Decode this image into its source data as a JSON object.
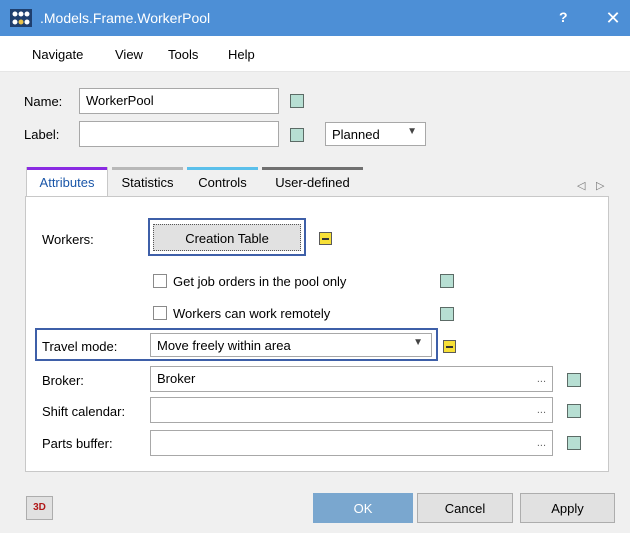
{
  "window": {
    "title": ".Models.Frame.WorkerPool",
    "help": "?",
    "close": "✕"
  },
  "menu": {
    "items": [
      "Navigate",
      "View",
      "Tools",
      "Help"
    ]
  },
  "name": {
    "label": "Name:",
    "value": "WorkerPool"
  },
  "label_field": {
    "label": "Label:",
    "value": ""
  },
  "status_combo": {
    "value": "Planned"
  },
  "tabs": [
    {
      "label": "Attributes",
      "color": "#8a2be2",
      "active": true
    },
    {
      "label": "Statistics",
      "color": "#b8b8b8",
      "active": false
    },
    {
      "label": "Controls",
      "color": "#5bc0eb",
      "active": false
    },
    {
      "label": "User-defined",
      "color": "#707070",
      "active": false
    }
  ],
  "tab_nav": {
    "left": "◁",
    "right": "▷"
  },
  "attributes": {
    "workers_label": "Workers:",
    "creation_table_button": "Creation Table",
    "pool_only_checkbox": "Get job orders in the pool only",
    "remote_checkbox": "Workers can work remotely",
    "travel_mode_label": "Travel mode:",
    "travel_mode_value": "Move freely within area",
    "broker_label": "Broker:",
    "broker_value": "Broker",
    "shift_calendar_label": "Shift calendar:",
    "shift_calendar_value": "",
    "parts_buffer_label": "Parts buffer:",
    "parts_buffer_value": "",
    "ellipsis": "..."
  },
  "footer": {
    "three_d": "3D",
    "ok": "OK",
    "cancel": "Cancel",
    "apply": "Apply"
  },
  "colors": {
    "titlebar": "#4d8fd6",
    "ok_button": "#7aa7cf",
    "focus_border": "#3e5fa8"
  }
}
